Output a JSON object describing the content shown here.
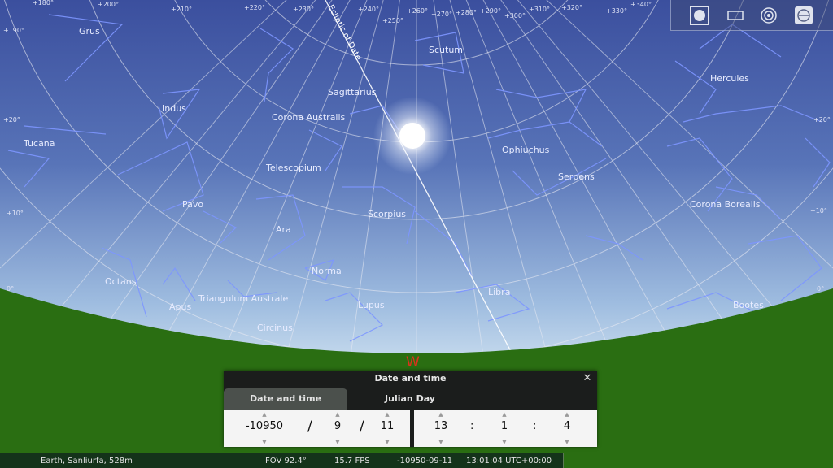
{
  "sky": {
    "compass_west": "W",
    "ecliptic_label": "Ecliptic of Date",
    "constellations": [
      "Grus",
      "Scutum",
      "Hercules",
      "Sagittarius",
      "Indus",
      "Corona Australis",
      "Tucana",
      "Ophiuchus",
      "Telescopium",
      "Serpens",
      "Pavo",
      "Corona Borealis",
      "Scorpius",
      "Ara",
      "Norma",
      "Octans",
      "Libra",
      "Triangulum Australe",
      "Apus",
      "Lupus",
      "Bootes",
      "Circinus"
    ],
    "grid_labels": [
      "+180°",
      "+190°",
      "+200°",
      "+210°",
      "+220°",
      "+230°",
      "+240°",
      "+250°",
      "+260°",
      "+270°",
      "+280°",
      "+290°",
      "+300°",
      "+310°",
      "+320°",
      "+330°",
      "+340°",
      "+20°",
      "+10°",
      "0°",
      "+20°",
      "+10°",
      "0°"
    ],
    "colors": {
      "sky_top": "#3b4f9e",
      "sky_bottom": "#cfe1f0",
      "ground": "#2a6e12",
      "compass": "#e0301c"
    }
  },
  "toolbar": {
    "icons": [
      "ground-toggle-icon",
      "grid-icon",
      "atmosphere-icon",
      "compass-icon"
    ]
  },
  "dialog": {
    "title": "Date and time",
    "close": "✕",
    "tabs": [
      "Date and time",
      "Julian Day"
    ],
    "active_tab": "Date and time",
    "date": {
      "year": "-10950",
      "month": "9",
      "day": "11"
    },
    "time": {
      "hour": "13",
      "minute": "1",
      "second": "4"
    },
    "separators": {
      "date": "/",
      "time": ":"
    },
    "arrow_up": "▲",
    "arrow_down": "▼"
  },
  "status": {
    "location": "Earth, Sanliurfa, 528m",
    "fov": "FOV 92.4°",
    "fps": "15.7 FPS",
    "date": "-10950-09-11",
    "time": "13:01:04 UTC+00:00"
  }
}
